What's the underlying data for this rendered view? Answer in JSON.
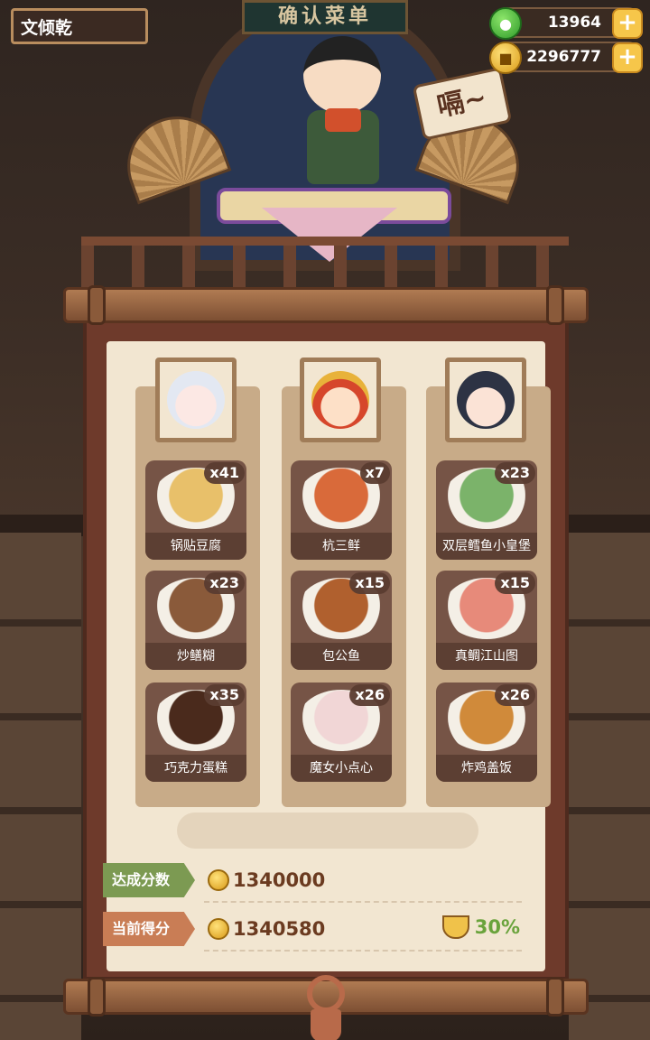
{
  "player": {
    "name": "文倾乾"
  },
  "currency": {
    "jade": {
      "value": "13964",
      "icon": "jade-coin-icon"
    },
    "gold": {
      "value": "2296777",
      "icon": "gold-coin-icon"
    }
  },
  "scene": {
    "sign_text": "确认菜单",
    "speech_text": "嗝~"
  },
  "columns": [
    {
      "portrait": "white-hair-customer-portrait",
      "dishes": [
        {
          "name": "锅贴豆腐",
          "count": "x41",
          "color": "#e8c06a"
        },
        {
          "name": "炒鳝糊",
          "count": "x23",
          "color": "#8a5a3a"
        },
        {
          "name": "巧克力蛋糕",
          "count": "x35",
          "color": "#4a2a1c"
        }
      ]
    },
    {
      "portrait": "golden-crown-customer-portrait",
      "dishes": [
        {
          "name": "杭三鲜",
          "count": "x7",
          "color": "#d96a3a"
        },
        {
          "name": "包公鱼",
          "count": "x15",
          "color": "#b0602e"
        },
        {
          "name": "魔女小点心",
          "count": "x26",
          "color": "#f1d6d6"
        }
      ]
    },
    {
      "portrait": "dark-hair-customer-portrait",
      "dishes": [
        {
          "name": "双层鳕鱼小皇堡",
          "count": "x23",
          "color": "#7bb36a"
        },
        {
          "name": "真鲷江山图",
          "count": "x15",
          "color": "#e78a7a"
        },
        {
          "name": "炸鸡盖饭",
          "count": "x26",
          "color": "#d08a3a"
        }
      ]
    }
  ],
  "score": {
    "goal_label": "达成分数",
    "goal_value": "1340000",
    "current_label": "当前得分",
    "current_value": "1340580",
    "percent": "30%"
  },
  "colors": {
    "goal_tag": "#7c9a52",
    "current_tag": "#c97d55",
    "percent_text": "#6aa33c",
    "score_text": "#6b3b20"
  }
}
